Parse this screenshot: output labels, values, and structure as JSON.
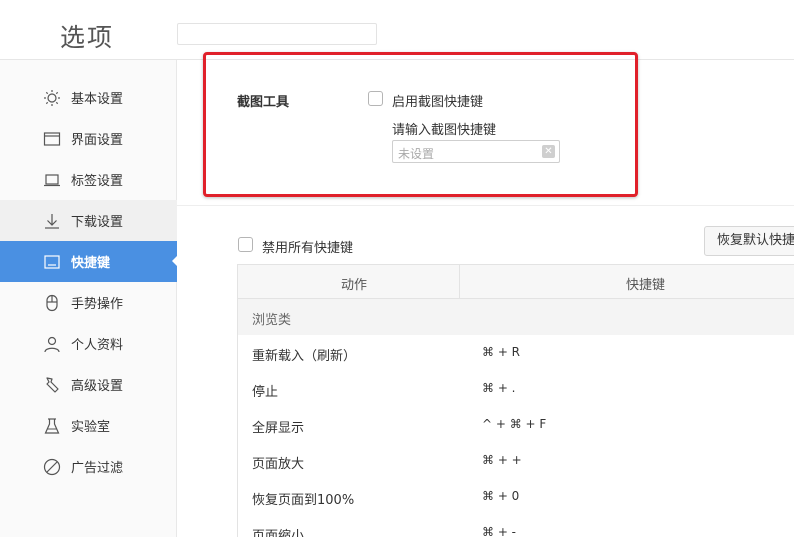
{
  "header": {
    "title": "选项",
    "search_value": ""
  },
  "sidebar": {
    "items": [
      {
        "label": "基本设置",
        "icon": "sun-icon"
      },
      {
        "label": "界面设置",
        "icon": "window-icon"
      },
      {
        "label": "标签设置",
        "icon": "laptop-icon"
      },
      {
        "label": "下载设置",
        "icon": "download-icon"
      },
      {
        "label": "快捷键",
        "icon": "keyboard-icon",
        "active": true
      },
      {
        "label": "手势操作",
        "icon": "mouse-icon"
      },
      {
        "label": "个人资料",
        "icon": "user-icon"
      },
      {
        "label": "高级设置",
        "icon": "wrench-icon"
      },
      {
        "label": "实验室",
        "icon": "flask-icon"
      },
      {
        "label": "广告过滤",
        "icon": "block-icon"
      }
    ]
  },
  "screenshot": {
    "label": "截图工具",
    "enable_label": "启用截图快捷键",
    "enabled": false,
    "hint": "请输入截图快捷键",
    "placeholder": "未设置"
  },
  "shortcuts": {
    "disable_all_label": "禁用所有快捷键",
    "disable_all": false,
    "restore_label": "恢复默认快捷键",
    "columns": [
      "动作",
      "快捷键"
    ],
    "group": "浏览类",
    "rows": [
      {
        "action": "重新载入（刷新）",
        "key": "⌘ + R"
      },
      {
        "action": "停止",
        "key": "⌘ + ."
      },
      {
        "action": "全屏显示",
        "key": "^ + ⌘ + F"
      },
      {
        "action": "页面放大",
        "key": "⌘ + +"
      },
      {
        "action": "恢复页面到100%",
        "key": "⌘ + 0"
      },
      {
        "action": "页面缩小",
        "key": "⌘ + -"
      }
    ]
  },
  "colors": {
    "accent": "#4a90e2",
    "highlight_border": "#e0202a"
  }
}
